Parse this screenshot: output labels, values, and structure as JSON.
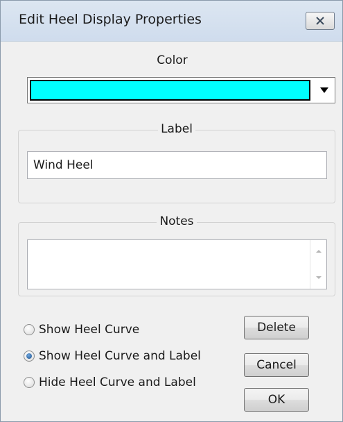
{
  "window": {
    "title": "Edit Heel Display Properties",
    "close_icon": "close-x-icon"
  },
  "color": {
    "label": "Color",
    "selected_color": "#00ffff",
    "dropdown_icon": "dropdown-arrow-icon"
  },
  "label_group": {
    "legend": "Label",
    "value": "Wind Heel"
  },
  "notes_group": {
    "legend": "Notes",
    "value": "",
    "scroll_up_icon": "scroll-up-arrow-icon",
    "scroll_down_icon": "scroll-down-arrow-icon"
  },
  "display_options": {
    "selected": 1,
    "options": [
      "Show Heel Curve",
      "Show Heel Curve and Label",
      "Hide Heel Curve and Label"
    ]
  },
  "buttons": {
    "delete": "Delete",
    "cancel": "Cancel",
    "ok": "OK"
  }
}
